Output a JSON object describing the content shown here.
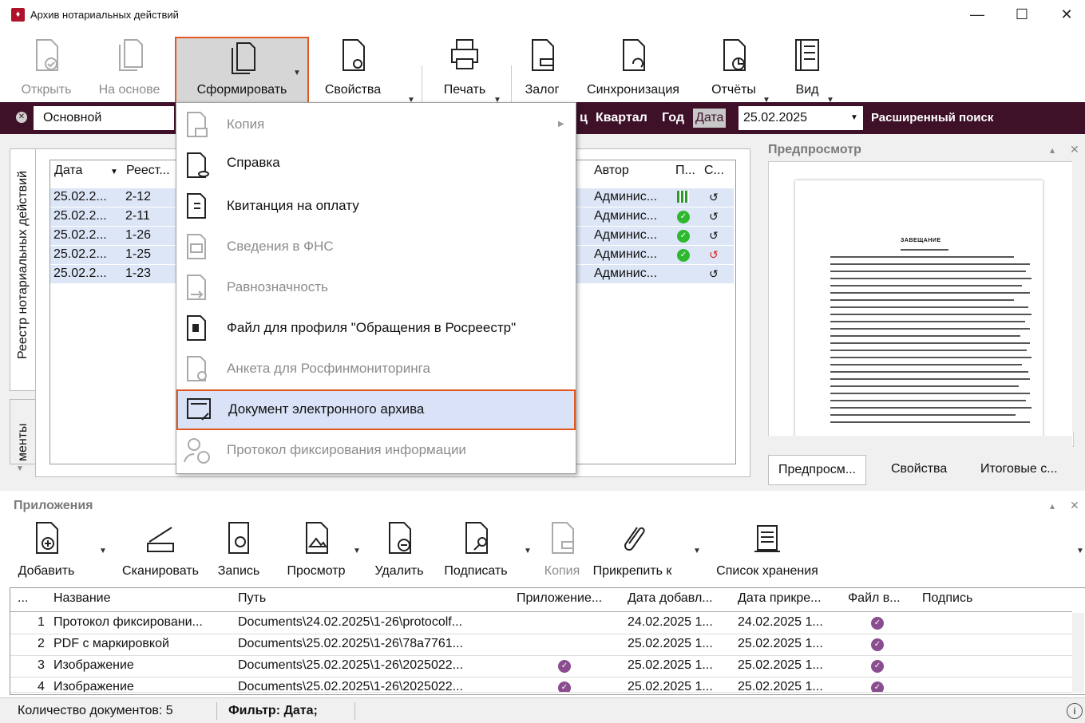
{
  "window": {
    "title": "Архив нотариальных действий",
    "minimize": "—",
    "maximize": "☐",
    "close": "✕"
  },
  "toolbar": {
    "open": "Открыть",
    "based_on": "На основе",
    "form": "Сформировать",
    "properties": "Свойства",
    "print": "Печать",
    "pledge": "Залог",
    "sync": "Синхронизация",
    "reports": "Отчёты",
    "view": "Вид"
  },
  "filter": {
    "main": "Основной",
    "prefix": "ц",
    "quarter": "Квартал",
    "year": "Год",
    "date_label": "Дата",
    "date_value": "25.02.2025",
    "advanced": "Расширенный поиск"
  },
  "sidetabs": {
    "registry": "Реестр нотариальных действий",
    "docs": "менты"
  },
  "grid": {
    "headers": {
      "date": "Дата",
      "registry": "Реест...",
      "author": "Автор",
      "p": "П...",
      "s": "С..."
    },
    "rows": [
      {
        "date": "25.02.2...",
        "reg": "2-12",
        "author": "Админис...",
        "p": "qr",
        "s": "green"
      },
      {
        "date": "25.02.2...",
        "reg": "2-11",
        "author": "Админис...",
        "p": "check",
        "s": "green"
      },
      {
        "date": "25.02.2...",
        "reg": "1-26",
        "author": "Админис...",
        "p": "check",
        "s": "green"
      },
      {
        "date": "25.02.2...",
        "reg": "1-25",
        "author": "Админис...",
        "p": "check",
        "s": "red"
      },
      {
        "date": "25.02.2...",
        "reg": "1-23",
        "author": "Админис...",
        "p": "",
        "s": "green"
      }
    ]
  },
  "dropdown": {
    "items": [
      {
        "label": "Копия",
        "enabled": false
      },
      {
        "label": "Справка",
        "enabled": true
      },
      {
        "label": "Квитанция на оплату",
        "enabled": true
      },
      {
        "label": "Сведения в ФНС",
        "enabled": false
      },
      {
        "label": "Равнозначность",
        "enabled": false
      },
      {
        "label": "Файл для профиля \"Обращения в Росреестр\"",
        "enabled": true
      },
      {
        "label": "Анкета для Росфинмониторинга",
        "enabled": false
      },
      {
        "label": "Документ электронного архива",
        "enabled": true
      },
      {
        "label": "Протокол фиксирования информации",
        "enabled": false
      }
    ]
  },
  "preview": {
    "title": "Предпросмотр",
    "doc_title": "ЗАВЕЩАНИЕ",
    "tabs": [
      "Предпросм...",
      "Свойства",
      "Итоговые с..."
    ]
  },
  "attachments": {
    "title": "Приложения",
    "buttons": {
      "add": "Добавить",
      "scan": "Сканировать",
      "record": "Запись",
      "view": "Просмотр",
      "delete": "Удалить",
      "sign": "Подписать",
      "copy": "Копия",
      "attach": "Прикрепить к",
      "storage_list": "Список хранения"
    },
    "headers": {
      "num": "...",
      "name": "Название",
      "path": "Путь",
      "app": "Приложение...",
      "added": "Дата добавл...",
      "attached": "Дата прикре...",
      "file": "Файл в...",
      "signature": "Подпись"
    },
    "rows": [
      {
        "num": "1",
        "name": "Протокол фиксировани...",
        "path": "Documents\\24.02.2025\\1-26\\protocolf...",
        "app": false,
        "added": "24.02.2025 1...",
        "attached": "24.02.2025 1...",
        "file": true
      },
      {
        "num": "2",
        "name": "PDF с маркировкой",
        "path": "Documents\\25.02.2025\\1-26\\78a7761...",
        "app": false,
        "added": "25.02.2025 1...",
        "attached": "25.02.2025 1...",
        "file": true
      },
      {
        "num": "3",
        "name": "Изображение",
        "path": "Documents\\25.02.2025\\1-26\\2025022...",
        "app": true,
        "added": "25.02.2025 1...",
        "attached": "25.02.2025 1...",
        "file": true
      },
      {
        "num": "4",
        "name": "Изображение",
        "path": "Documents\\25.02.2025\\1-26\\2025022...",
        "app": true,
        "added": "25.02.2025 1...",
        "attached": "25.02.2025 1...",
        "file": true
      }
    ]
  },
  "status": {
    "count": "Количество документов: 5",
    "filter": "Фильтр: Дата;",
    "info": "i"
  },
  "colors": {
    "accent": "#3e1128",
    "highlight_border": "#e25822",
    "selection": "#dde6f7",
    "check": "#8a4d8f"
  }
}
